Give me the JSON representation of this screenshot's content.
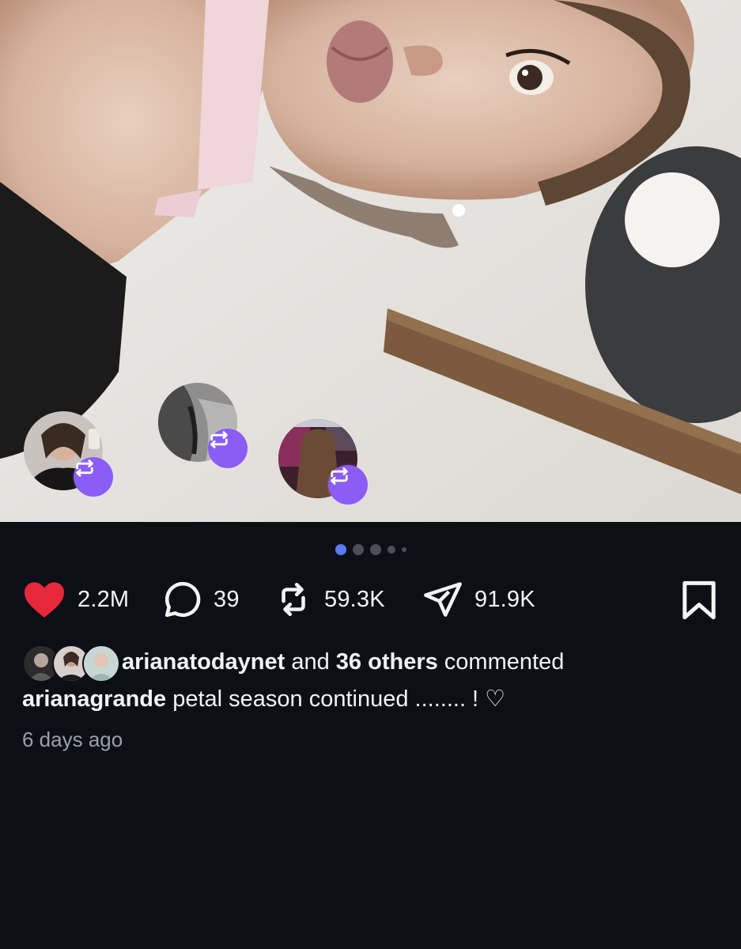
{
  "post": {
    "carousel": {
      "count": 5,
      "active_index": 0
    },
    "repost_avatars": [
      {
        "icon": "repost-icon"
      },
      {
        "icon": "repost-icon"
      },
      {
        "icon": "repost-icon"
      }
    ]
  },
  "actions": {
    "likes": "2.2M",
    "comments": "39",
    "reposts": "59.3K",
    "shares": "91.9K"
  },
  "commenters": {
    "first_user": "arianatodaynet",
    "connector": " and ",
    "others": "36 others",
    "suffix": " commented"
  },
  "caption": {
    "username": "arianagrande",
    "text": " petal season continued ........ ! ♡"
  },
  "timestamp": "6 days ago",
  "colors": {
    "background": "#0c0f15",
    "like_red": "#e5293b",
    "repost_purple": "#8b5cf6",
    "active_dot": "#5b7cf0",
    "muted_text": "#9aa0aa"
  }
}
